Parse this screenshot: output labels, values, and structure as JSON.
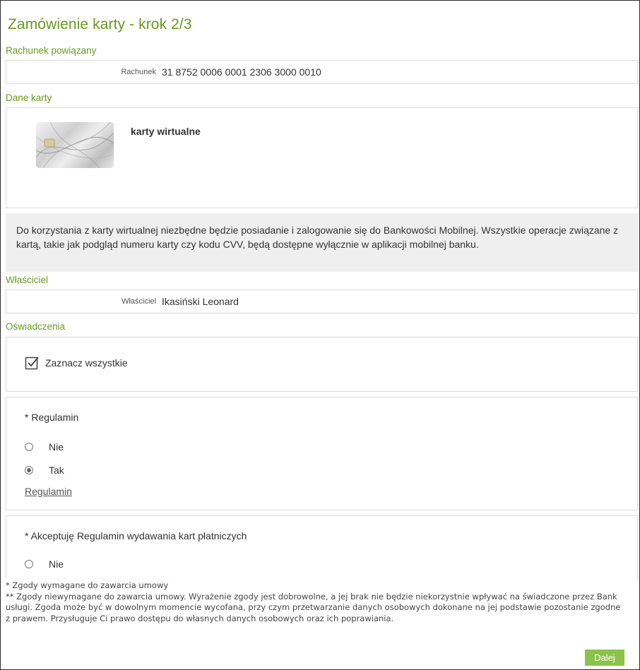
{
  "page": {
    "title": "Zamówienie karty - krok 2/3"
  },
  "linked_account": {
    "section_label": "Rachunek powiązany",
    "field_label": "Rachunek",
    "field_value": "31 8752 0006 0001 2306 3000 0010"
  },
  "card": {
    "section_label": "Dane karty",
    "name": "karty wirtualne",
    "info": "Do korzystania z karty wirtualnej niezbędne będzie posiadanie i zalogowanie się do Bankowości Mobilnej. Wszystkie operacje związane z kartą, takie jak podgląd numeru karty czy kodu CVV, będą dostępne wyłącznie w aplikacji mobilnej banku."
  },
  "owner": {
    "section_label": "Właściciel",
    "field_label": "Właściciel",
    "field_value": "Ikasiński Leonard"
  },
  "statements": {
    "section_label": "Oświadczenia",
    "select_all_label": "Zaznacz wszystkie",
    "select_all_checked": true,
    "items": [
      {
        "question": "* Regulamin",
        "options": [
          {
            "label": "Nie",
            "checked": false
          },
          {
            "label": "Tak",
            "checked": true
          }
        ],
        "link": "Regulamin"
      },
      {
        "question": "* Akceptuję Regulamin wydawania kart płatniczych",
        "options": [
          {
            "label": "Nie",
            "checked": false
          }
        ]
      }
    ]
  },
  "footnotes": {
    "required": "* Zgody wymagane do zawarcia umowy",
    "optional": "** Zgody niewymagane do zawarcia umowy. Wyrażenie zgody jest dobrowolne, a jej brak nie będzie niekorzystnie wpływać na świadczone przez Bank usługi. Zgoda może być w dowolnym momencie wycofana, przy czym przetwarzanie danych osobowych dokonane na jej podstawie pozostanie zgodne z prawem. Przysługuje Ci prawo dostępu do własnych danych osobowych oraz ich poprawiania."
  },
  "actions": {
    "next_label": "Dalej"
  },
  "colors": {
    "accent_green": "#6a9a21",
    "button_green": "#8bc34a",
    "info_bg": "#efefef"
  }
}
